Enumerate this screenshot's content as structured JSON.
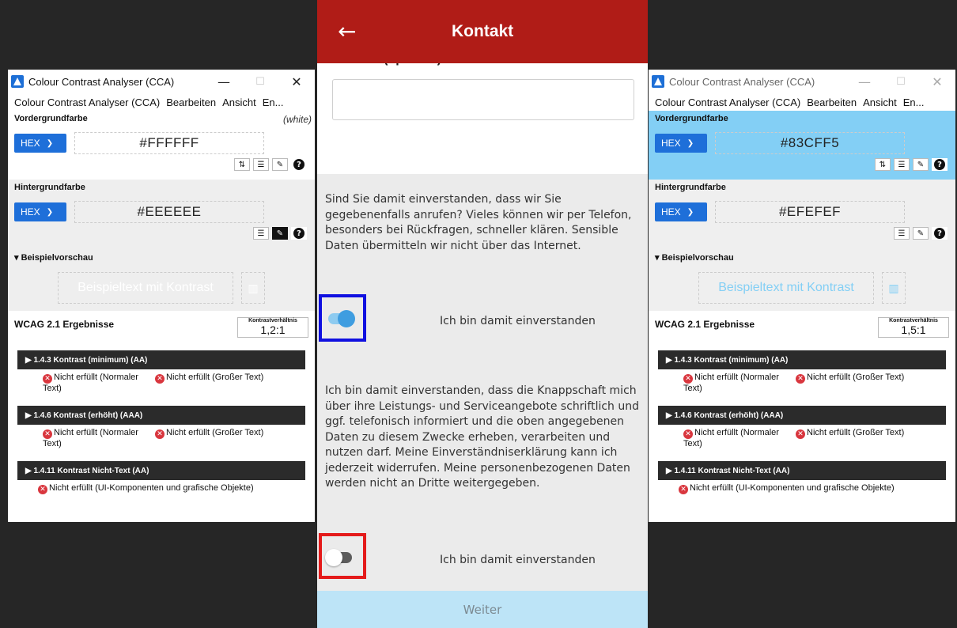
{
  "left_cca": {
    "title": "Colour Contrast Analyser (CCA)",
    "menu": [
      "Colour Contrast Analyser (CCA)",
      "Bearbeiten",
      "Ansicht",
      "En..."
    ],
    "foreground": {
      "label": "Vordergrundfarbe",
      "note": "(white)",
      "format": "HEX",
      "value": "#FFFFFF",
      "color": "#FFFFFF"
    },
    "background": {
      "label": "Hintergrundfarbe",
      "format": "HEX",
      "value": "#EEEEEE",
      "color": "#EEEEEE"
    },
    "preview": {
      "label": "▾ Beispielvorschau",
      "text": "Beispieltext mit Kontrast"
    },
    "results": {
      "title": "WCAG 2.1 Ergebnisse",
      "ratio_label": "Kontrastverhältnis",
      "ratio": "1,2:1",
      "criteria": [
        {
          "title": "▶ 1.4.3 Kontrast (minimum) (AA)",
          "r1": "Nicht erfüllt (Normaler Text)",
          "r2": "Nicht erfüllt (Großer Text)"
        },
        {
          "title": "▶ 1.4.6 Kontrast (erhöht) (AAA)",
          "r1": "Nicht erfüllt (Normaler Text)",
          "r2": "Nicht erfüllt (Großer Text)"
        },
        {
          "title": "▶ 1.4.11 Kontrast Nicht-Text (AA)",
          "r1": "Nicht erfüllt (UI-Komponenten und grafische Objekte)"
        }
      ]
    }
  },
  "right_cca": {
    "title": "Colour Contrast Analyser (CCA)",
    "menu": [
      "Colour Contrast Analyser (CCA)",
      "Bearbeiten",
      "Ansicht",
      "En..."
    ],
    "foreground": {
      "label": "Vordergrundfarbe",
      "format": "HEX",
      "value": "#83CFF5",
      "color": "#83CFF5"
    },
    "background": {
      "label": "Hintergrundfarbe",
      "format": "HEX",
      "value": "#EFEFEF",
      "color": "#EFEFEF"
    },
    "preview": {
      "label": "▾ Beispielvorschau",
      "text": "Beispieltext mit Kontrast"
    },
    "results": {
      "title": "WCAG 2.1 Ergebnisse",
      "ratio_label": "Kontrastverhältnis",
      "ratio": "1,5:1",
      "criteria": [
        {
          "title": "▶ 1.4.3 Kontrast (minimum) (AA)",
          "r1": "Nicht erfüllt (Normaler Text)",
          "r2": "Nicht erfüllt (Großer Text)"
        },
        {
          "title": "▶ 1.4.6 Kontrast (erhöht) (AAA)",
          "r1": "Nicht erfüllt (Normaler Text)",
          "r2": "Nicht erfüllt (Großer Text)"
        },
        {
          "title": "▶ 1.4.11 Kontrast Nicht-Text (AA)",
          "r1": "Nicht erfüllt (UI-Komponenten und grafische Objekte)"
        }
      ]
    }
  },
  "phone": {
    "back_icon": "arrow-left-icon",
    "title": "Kontakt",
    "field_label": "Telefon (optional)",
    "field_value": "",
    "consent_call_text": "Sind Sie damit einverstanden, dass wir Sie gegebenenfalls anrufen? Vieles können wir per Telefon, besonders bei Rückfragen, schneller klären. Sensible Daten übermitteln wir nicht über das Internet.",
    "toggle1": {
      "label": "Ich bin damit einverstanden",
      "checked": true,
      "highlight_color": "#1010E0"
    },
    "consent_info_text": "Ich bin damit einverstanden, dass die Knappschaft mich über ihre Leistungs- und Serviceangebote schriftlich und ggf. telefonisch informiert und die oben angegebenen Daten zu diesem Zwecke erheben, verarbeiten und nutzen darf. Meine Einverständniserklärung kann ich jederzeit widerrufen. Meine personenbezogenen Daten werden nicht an Dritte weitergegeben.",
    "toggle2": {
      "label": "Ich bin damit einverstanden",
      "checked": false,
      "highlight_color": "#E41B1B"
    },
    "continue_button": "Weiter",
    "accent_color": "#B01C17"
  }
}
